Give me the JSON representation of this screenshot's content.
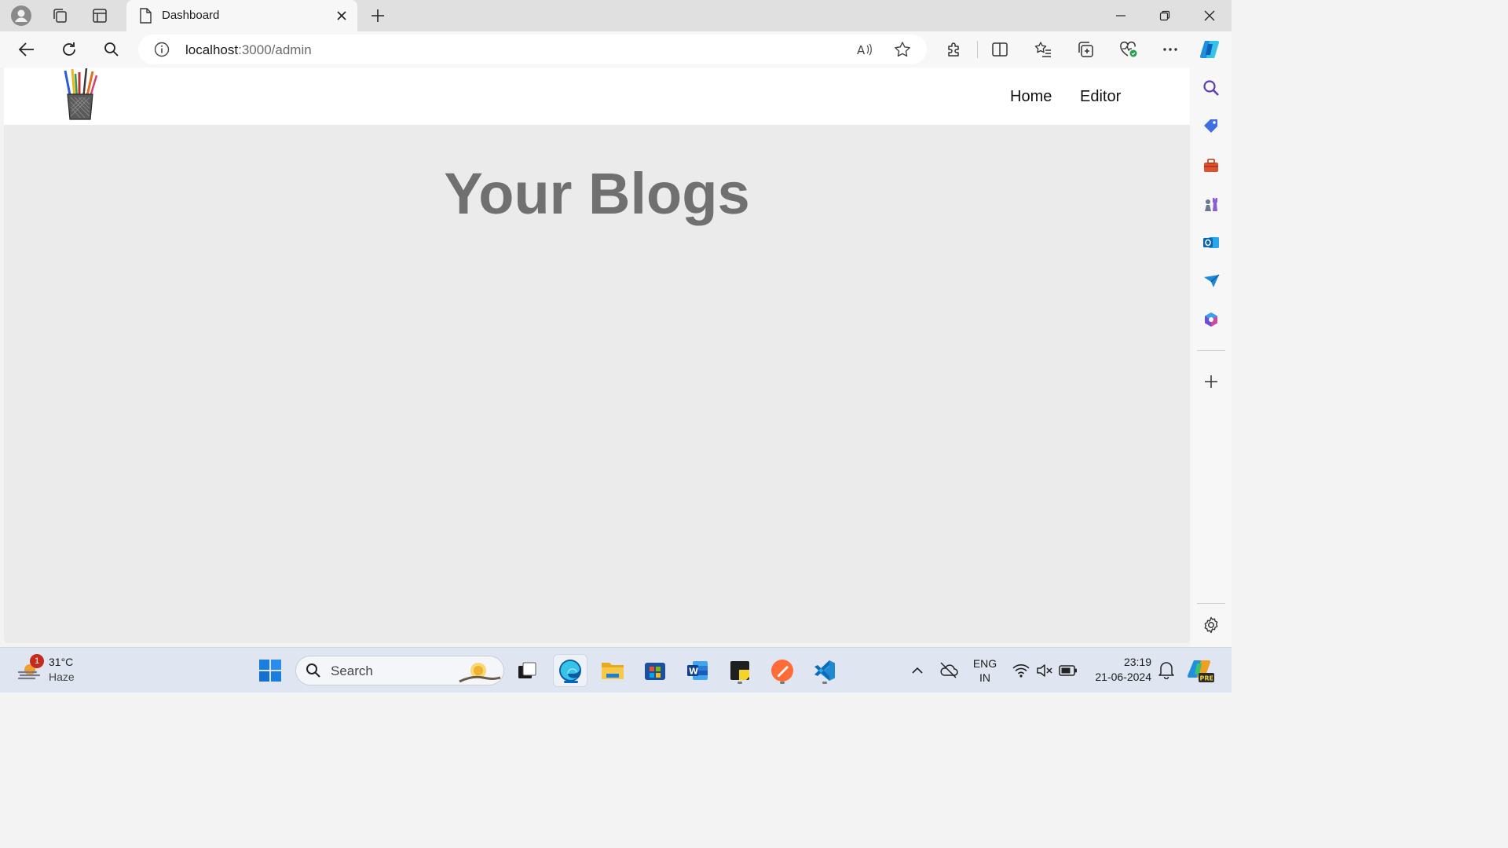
{
  "browser": {
    "tab": {
      "title": "Dashboard"
    },
    "url": {
      "host": "localhost",
      "path": ":3000/admin"
    }
  },
  "site": {
    "nav": {
      "home": "Home",
      "editor": "Editor"
    },
    "heading": "Your Blogs"
  },
  "taskbar": {
    "weather": {
      "temp": "31°C",
      "condition": "Haze",
      "badge": "1"
    },
    "search_placeholder": "Search",
    "language": {
      "line1": "ENG",
      "line2": "IN"
    },
    "clock": {
      "time": "23:19",
      "date": "21-06-2024"
    }
  },
  "colors": {
    "page_background": "#ebebeb",
    "heading": "#707070",
    "edge_blue": "#0c59a4",
    "vscode_blue": "#1f8ad2"
  }
}
